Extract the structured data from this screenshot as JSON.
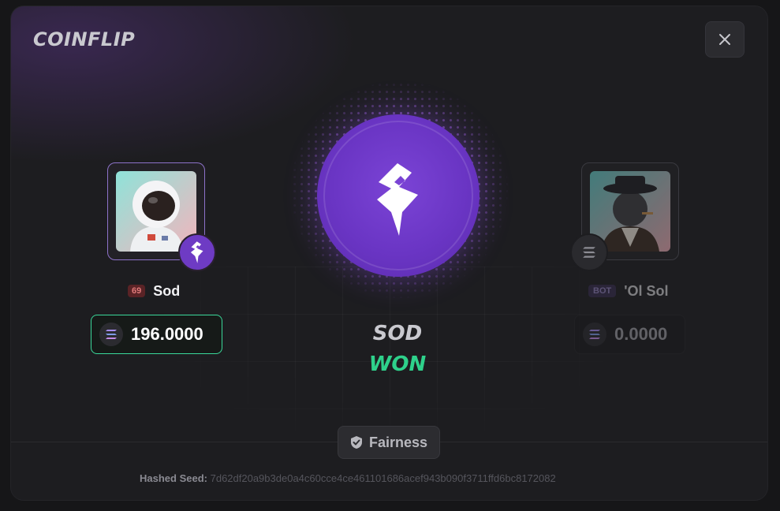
{
  "modal": {
    "title": "COINFLIP",
    "close_icon": "close-icon"
  },
  "player_left": {
    "level": "69",
    "name": "Sod",
    "amount": "196.0000",
    "side_icon": "brand-logo-icon",
    "currency_icon": "solana-icon",
    "highlight_color": "#3ad89a"
  },
  "player_right": {
    "tag": "BOT",
    "name": "'Ol Sol",
    "amount": "0.0000",
    "side_icon": "solana-icon",
    "currency_icon": "solana-icon"
  },
  "result": {
    "winner": "SOD",
    "status": "WON",
    "status_color": "#2ed18b",
    "coin_color": "#6a35c4"
  },
  "footer": {
    "fairness_label": "Fairness",
    "fairness_icon": "shield-check-icon",
    "seed_label": "Hashed Seed:",
    "seed_value": "7d62df20a9b3de0a4c60cce4ce461101686acef943b090f3711ffd6bc8172082"
  }
}
